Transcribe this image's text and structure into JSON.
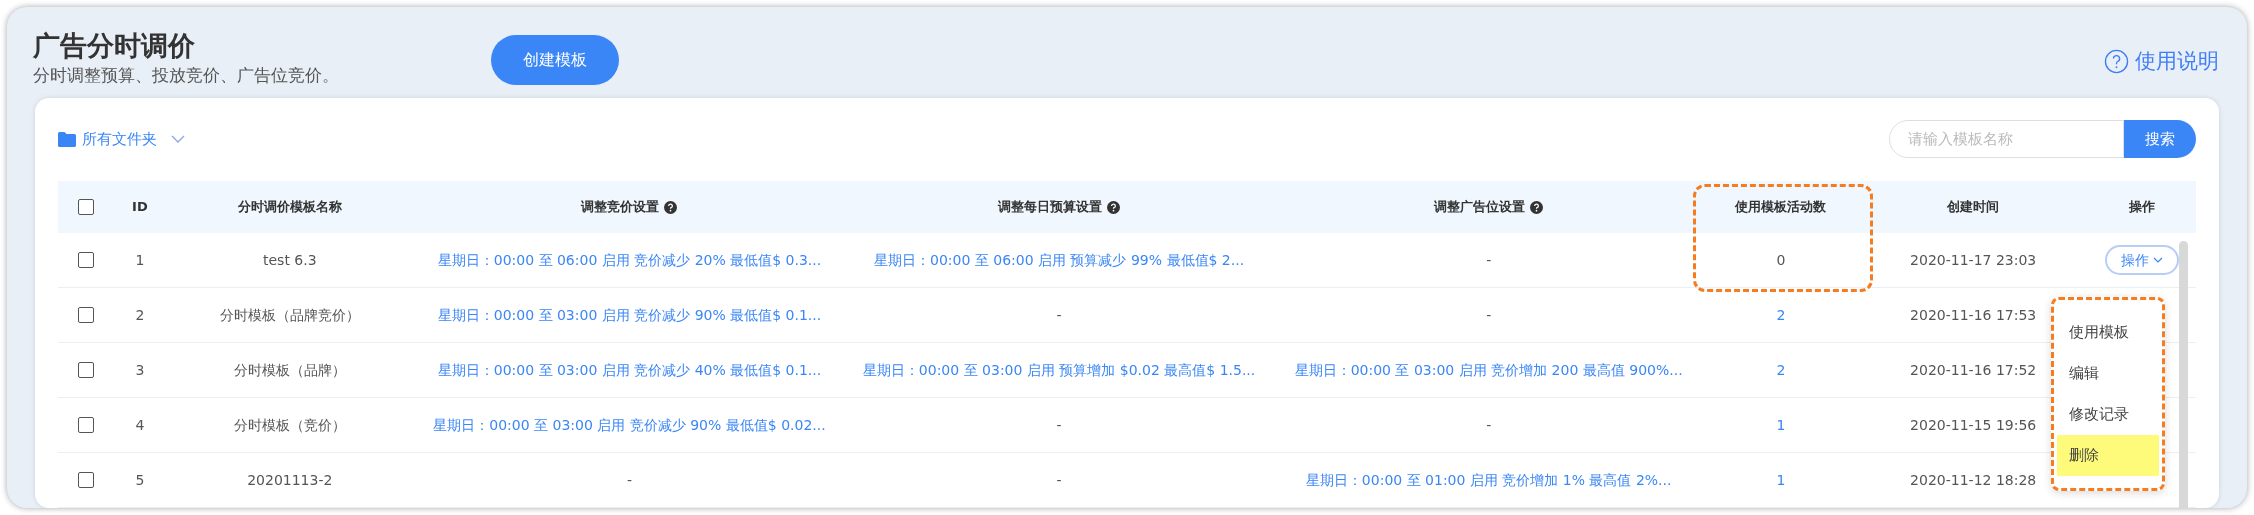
{
  "header": {
    "title": "广告分时调价",
    "subtitle": "分时调整预算、投放竞价、广告位竞价。",
    "create_button": "创建模板",
    "help_link": "使用说明"
  },
  "toolbar": {
    "folder": "所有文件夹",
    "search": {
      "placeholder": "请输入模板名称"
    },
    "search_button": "搜索"
  },
  "table": {
    "select_all": {
      "checked": false
    },
    "columns": [
      {
        "label": "ID",
        "kind": "plain"
      },
      {
        "label": "分时调价模板名称",
        "kind": "plain"
      },
      {
        "label": "调整竞价设置",
        "kind": "help"
      },
      {
        "label": "调整每日预算设置",
        "kind": "help"
      },
      {
        "label": "调整广告位设置",
        "kind": "help"
      },
      {
        "label": "使用模板活动数",
        "kind": "annotated"
      },
      {
        "label": "创建时间",
        "kind": "plain"
      },
      {
        "label": "操作",
        "kind": "plain"
      }
    ],
    "rows": [
      {
        "checked": false,
        "id": "1",
        "name": "test 6.3",
        "bid": {
          "text": "星期日：00:00 至 06:00 启用 竞价减少 20% 最低值$ 0.3...",
          "link": true
        },
        "budget": {
          "text": "星期日：00:00 至 06:00 启用 预算减少 99% 最低值$ 2...",
          "link": true
        },
        "placement": {
          "text": "-",
          "link": false
        },
        "count": {
          "text": "0",
          "link": false
        },
        "created": "2020-11-17 23:03",
        "action": "操作"
      },
      {
        "checked": false,
        "id": "2",
        "name": "分时模板（品牌竞价）",
        "bid": {
          "text": "星期日：00:00 至 03:00 启用 竞价减少 90% 最低值$ 0.1...",
          "link": true
        },
        "budget": {
          "text": "-",
          "link": false
        },
        "placement": {
          "text": "-",
          "link": false
        },
        "count": {
          "text": "2",
          "link": true
        },
        "created": "2020-11-16 17:53"
      },
      {
        "checked": false,
        "id": "3",
        "name": "分时模板（品牌）",
        "bid": {
          "text": "星期日：00:00 至 03:00 启用 竞价减少 40% 最低值$ 0.1...",
          "link": true
        },
        "budget": {
          "text": "星期日：00:00 至 03:00 启用 预算增加 $0.02 最高值$ 1.5...",
          "link": true
        },
        "placement": {
          "text": "星期日：00:00 至 03:00 启用 竞价增加 200 最高值 900%...",
          "link": true
        },
        "count": {
          "text": "2",
          "link": true
        },
        "created": "2020-11-16 17:52"
      },
      {
        "checked": false,
        "id": "4",
        "name": "分时模板（竞价）",
        "bid": {
          "text": "星期日：00:00 至 03:00 启用 竞价减少 90% 最低值$ 0.02...",
          "link": true
        },
        "budget": {
          "text": "-",
          "link": false
        },
        "placement": {
          "text": "-",
          "link": false
        },
        "count": {
          "text": "1",
          "link": true
        },
        "created": "2020-11-15 19:56"
      },
      {
        "checked": false,
        "id": "5",
        "name": "20201113-2",
        "bid": {
          "text": "-",
          "link": false
        },
        "budget": {
          "text": "-",
          "link": false
        },
        "placement": {
          "text": "星期日：00:00 至 01:00 启用 竞价增加 1% 最高值 2%...",
          "link": true
        },
        "count": {
          "text": "1",
          "link": true
        },
        "created": "2020-11-12 18:28"
      }
    ]
  },
  "action_menu": {
    "outlined": true,
    "items": [
      {
        "label": "使用模板",
        "highlighted": false
      },
      {
        "label": "编辑",
        "highlighted": false
      },
      {
        "label": "修改记录",
        "highlighted": false
      },
      {
        "label": "删除",
        "highlighted": true
      }
    ]
  }
}
